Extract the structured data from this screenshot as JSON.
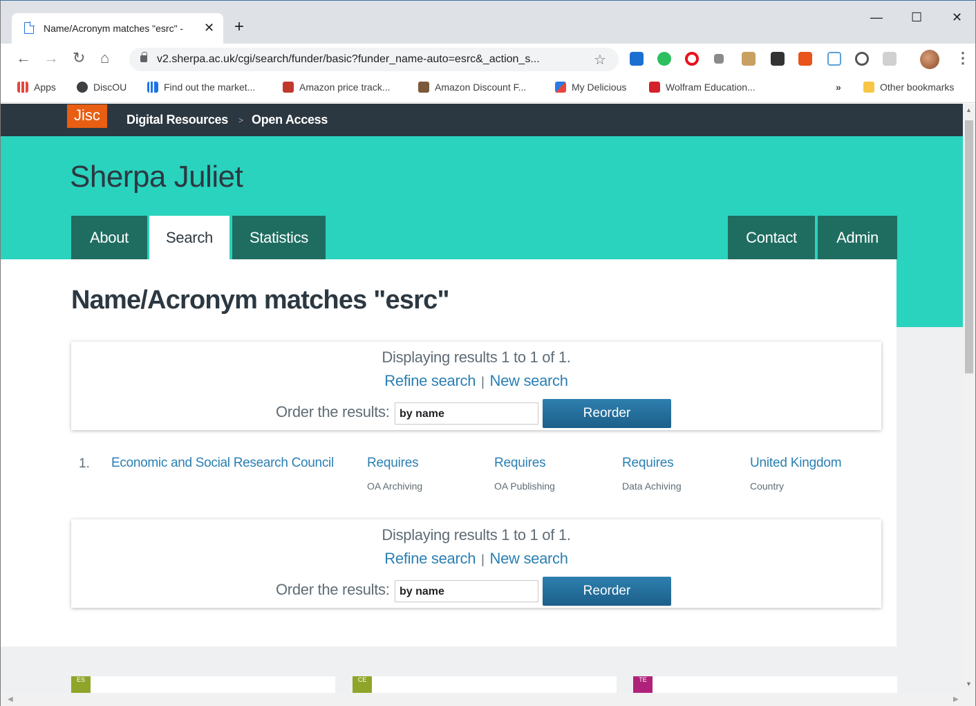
{
  "browser": {
    "tab_title": "Name/Acronym matches \"esrc\" - ",
    "new_tab": "+",
    "close_tab": "✕",
    "window_controls": {
      "minimize": "—",
      "maximize": "☐",
      "close": "✕"
    },
    "url": "v2.sherpa.ac.uk/cgi/search/funder/basic?funder_name-auto=esrc&_action_s...",
    "bookmarks": [
      {
        "label": "Apps",
        "icon": "apps-grid-icon",
        "color": "#e8453c"
      },
      {
        "label": "DiscOU",
        "icon": "disc-icon",
        "color": "#3c4043"
      },
      {
        "label": "Find out the market...",
        "icon": "bars-chart-icon",
        "color": "#1a73e8"
      },
      {
        "label": "Amazon price track...",
        "icon": "camel-icon",
        "color": "#c0392b"
      },
      {
        "label": "Amazon Discount F...",
        "icon": "person-icon",
        "color": "#7a5a3a"
      },
      {
        "label": "My Delicious",
        "icon": "delicious-icon",
        "color": "#2a7ae2"
      },
      {
        "label": "Wolfram Education...",
        "icon": "wolfram-icon",
        "color": "#d3202a"
      }
    ],
    "overflow": "»",
    "other_bookmarks": "Other bookmarks"
  },
  "site": {
    "brand": "Jisc",
    "breadcrumb": [
      "Digital Resources",
      "Open Access"
    ],
    "breadcrumb_sep": ">",
    "title": "Sherpa Juliet",
    "nav_left": [
      "About",
      "Search",
      "Statistics"
    ],
    "nav_right": [
      "Contact",
      "Admin"
    ],
    "active_tab": "Search",
    "accent": "#2ad3bd",
    "dark": "#2c3841"
  },
  "main": {
    "heading": "Name/Acronym matches \"esrc\"",
    "results_top": {
      "display": "Displaying results 1 to 1 of 1.",
      "refine": "Refine search",
      "sep": "|",
      "new": "New search",
      "order_label": "Order the results:",
      "order_value": "by name",
      "reorder": "Reorder"
    },
    "results_bottom": {
      "display": "Displaying results 1 to 1 of 1.",
      "refine": "Refine search",
      "sep": "|",
      "new": "New search",
      "order_label": "Order the results:",
      "order_value": "by name",
      "reorder": "Reorder"
    },
    "result": {
      "number": "1.",
      "name": "Economic and Social Research Council",
      "columns": [
        {
          "main": "Requires",
          "sub": "OA Archiving"
        },
        {
          "main": "Requires",
          "sub": "OA Publishing"
        },
        {
          "main": "Requires",
          "sub": "Data Achiving"
        },
        {
          "main": "United Kingdom",
          "sub": "Country"
        }
      ]
    }
  },
  "footer": {
    "cards": [
      {
        "tag": "ES",
        "color": "#8fa52a"
      },
      {
        "tag": "CE",
        "color": "#8fa52a"
      },
      {
        "tag": "TE",
        "color": "#b0227a"
      }
    ]
  }
}
